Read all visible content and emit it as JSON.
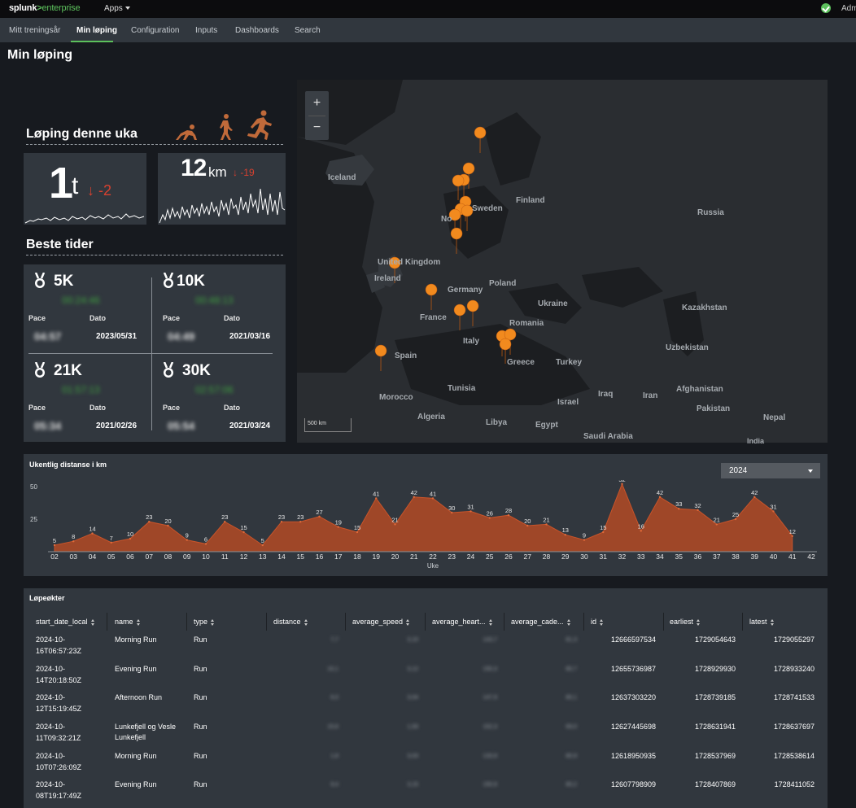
{
  "topbar": {
    "logo_splunk": "splunk",
    "logo_gt": ">",
    "logo_enterprise": "enterprise",
    "apps_label": "Apps",
    "admin_label": "Adm"
  },
  "nav": {
    "items": [
      "Mitt treningsår",
      "Min løping",
      "Configuration",
      "Inputs",
      "Dashboards",
      "Search"
    ],
    "active_index": 1
  },
  "page_title": "Min løping",
  "week": {
    "title": "Løping denne uka",
    "hours_value": "1",
    "hours_unit": "t",
    "hours_delta": "-2",
    "km_value": "12",
    "km_unit": "km",
    "km_delta": "-19"
  },
  "best_times": {
    "title": "Beste tider",
    "pace_label": "Pace",
    "date_label": "Dato",
    "items": [
      {
        "name": "5K",
        "time": "00:24:46",
        "pace": "04:57",
        "date": "2023/05/31"
      },
      {
        "name": "10K",
        "time": "00:48:13",
        "pace": "04:49",
        "date": "2021/03/16"
      },
      {
        "name": "21K",
        "time": "01:57:13",
        "pace": "05:34",
        "date": "2021/02/26"
      },
      {
        "name": "30K",
        "time": "02:57:06",
        "pace": "05:54",
        "date": "2021/03/24"
      }
    ]
  },
  "map": {
    "zoom_in": "+",
    "zoom_out": "−",
    "scale_label": "500 km",
    "countries": [
      "Iceland",
      "Finland",
      "Sweden",
      "No",
      "Russia",
      "United Kingdom",
      "Ireland",
      "Poland",
      "Germany",
      "Ukraine",
      "France",
      "Kazakhstan",
      "Romania",
      "Italy",
      "Uzbekistan",
      "Spain",
      "Greece",
      "Turkey",
      "Tunisia",
      "Iraq",
      "Iran",
      "Afghanistan",
      "Morocco",
      "Israel",
      "Pakistan",
      "Algeria",
      "Libya",
      "Egypt",
      "Saudi Arabia",
      "Nepal",
      "India"
    ],
    "marker_color": "#f28a1e"
  },
  "chart_data": {
    "type": "area",
    "title": "Ukentlig distanse i km",
    "xlabel": "Uke",
    "ylabel": "",
    "ylim": [
      0,
      55
    ],
    "yticks": [
      25,
      50
    ],
    "categories": [
      "02",
      "03",
      "04",
      "05",
      "06",
      "07",
      "08",
      "09",
      "10",
      "11",
      "12",
      "13",
      "14",
      "15",
      "16",
      "17",
      "18",
      "19",
      "20",
      "21",
      "22",
      "23",
      "24",
      "25",
      "26",
      "27",
      "28",
      "29",
      "30",
      "31",
      "32",
      "33",
      "34",
      "35",
      "36",
      "37",
      "38",
      "39",
      "40",
      "41",
      "42"
    ],
    "values": [
      5,
      8,
      14,
      7,
      10,
      23,
      20,
      9,
      6,
      23,
      15,
      5,
      23,
      23,
      27,
      19,
      15,
      41,
      21,
      42,
      41,
      30,
      31,
      26,
      28,
      20,
      21,
      13,
      9,
      15,
      52,
      16,
      42,
      33,
      32,
      21,
      25,
      42,
      31,
      12
    ],
    "value_labels": [
      5,
      8,
      14,
      7,
      10,
      23,
      20,
      9,
      6,
      23,
      15,
      5,
      23,
      23,
      27,
      19,
      15,
      41,
      21,
      42,
      41,
      30,
      31,
      26,
      28,
      20,
      21,
      13,
      9,
      15,
      52,
      16,
      42,
      33,
      32,
      21,
      25,
      42,
      31,
      12
    ],
    "color": "#b34a24",
    "year_selected": "2024"
  },
  "table": {
    "title": "Løpeøkter",
    "columns": [
      "start_date_local",
      "name",
      "type",
      "distance",
      "average_speed",
      "average_heart...",
      "average_cade...",
      "id",
      "earliest",
      "latest"
    ],
    "rows": [
      {
        "date1": "2024-10-",
        "date2": "16T06:57:23Z",
        "name1": "Morning Run",
        "name2": "",
        "type": "Run",
        "distance": "7,7",
        "speed": "3,10",
        "heart": "143,7",
        "cadence": "81,3",
        "id": "12666597534",
        "earliest": "1729054643",
        "latest": "1729055297"
      },
      {
        "date1": "2024-10-",
        "date2": "14T20:18:50Z",
        "name1": "Evening Run",
        "name2": "",
        "type": "Run",
        "distance": "10,1",
        "speed": "3,12",
        "heart": "150,3",
        "cadence": "80,7",
        "id": "12655736987",
        "earliest": "1728929930",
        "latest": "1728933240"
      },
      {
        "date1": "2024-10-",
        "date2": "12T15:19:45Z",
        "name1": "Afternoon Run",
        "name2": "",
        "type": "Run",
        "distance": "6,0",
        "speed": "3,04",
        "heart": "147,9",
        "cadence": "80,1",
        "id": "12637303220",
        "earliest": "1728739185",
        "latest": "1728741533"
      },
      {
        "date1": "2024-10-",
        "date2": "11T09:32:21Z",
        "name1": "Lunkefjell og Vesle",
        "name2": "Lunkefjell",
        "type": "Run",
        "distance": "15,6",
        "speed": "1,93",
        "heart": "152,3",
        "cadence": "69,0",
        "id": "12627445698",
        "earliest": "1728631941",
        "latest": "1728637697"
      },
      {
        "date1": "2024-10-",
        "date2": "10T07:26:09Z",
        "name1": "Morning Run",
        "name2": "",
        "type": "Run",
        "distance": "1,8",
        "speed": "3,03",
        "heart": "133,9",
        "cadence": "80,9",
        "id": "12618950935",
        "earliest": "1728537969",
        "latest": "1728538614"
      },
      {
        "date1": "2024-10-",
        "date2": "08T19:17:49Z",
        "name1": "Evening Run",
        "name2": "",
        "type": "Run",
        "distance": "9,4",
        "speed": "3,15",
        "heart": "150,9",
        "cadence": "80,2",
        "id": "12607798909",
        "earliest": "1728407869",
        "latest": "1728411052"
      }
    ]
  }
}
